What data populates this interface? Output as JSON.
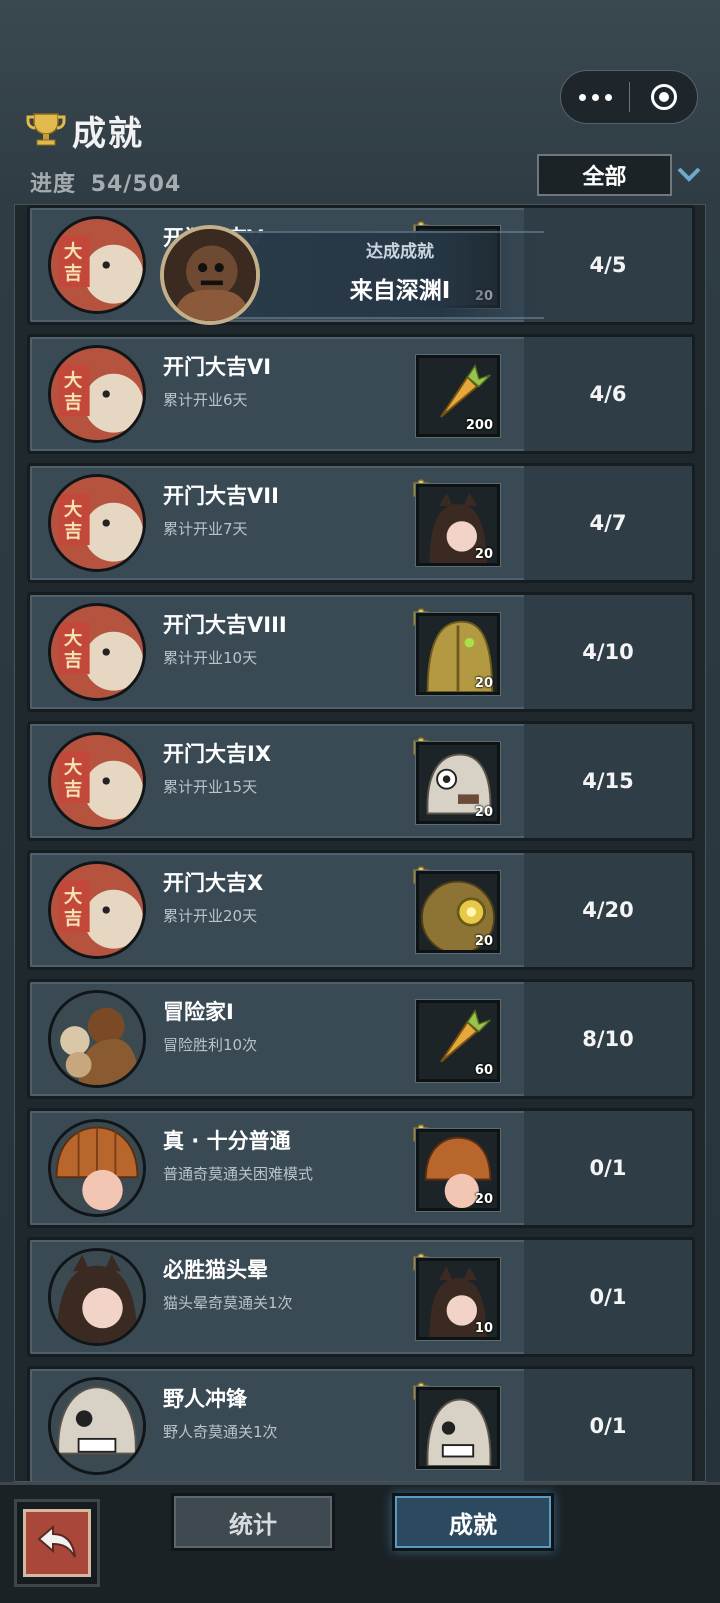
{
  "header": {
    "title": "成就",
    "progress_label": "进度",
    "progress_value": "54/504",
    "filter_value": "全部"
  },
  "toast": {
    "label": "达成成就",
    "title": "来自深渊I"
  },
  "achievements": [
    {
      "name": "开门大吉V",
      "desc": "",
      "reward_qty": "20",
      "count": "4/5",
      "portrait": "daji-lion-portrait"
    },
    {
      "name": "开门大吉VI",
      "desc": "累计开业6天",
      "reward_qty": "200",
      "count": "4/6",
      "portrait": "daji-lion-portrait",
      "reward_icon": "carrot-icon"
    },
    {
      "name": "开门大吉VII",
      "desc": "累计开业7天",
      "reward_qty": "20",
      "count": "4/7",
      "portrait": "daji-lion-portrait",
      "reward_icon": "cat-girl-shard-icon"
    },
    {
      "name": "开门大吉VIII",
      "desc": "累计开业10天",
      "reward_qty": "20",
      "count": "4/10",
      "portrait": "daji-lion-portrait",
      "reward_icon": "golden-helmet-shard-icon"
    },
    {
      "name": "开门大吉IX",
      "desc": "累计开业15天",
      "reward_qty": "20",
      "count": "4/15",
      "portrait": "daji-lion-portrait",
      "reward_icon": "skull-mask-shard-icon"
    },
    {
      "name": "开门大吉X",
      "desc": "累计开业20天",
      "reward_qty": "20",
      "count": "4/20",
      "portrait": "daji-lion-portrait",
      "reward_icon": "brass-diver-shard-icon"
    },
    {
      "name": "冒险家I",
      "desc": "冒险胜利10次",
      "reward_qty": "60",
      "count": "8/10",
      "portrait": "adventurer-portrait",
      "reward_icon": "carrot-icon"
    },
    {
      "name": "真 · 十分普通",
      "desc": "普通奇莫通关困难模式",
      "reward_qty": "20",
      "count": "0/1",
      "portrait": "pumpkin-head-portrait",
      "reward_icon": "pumpkin-head-shard-icon"
    },
    {
      "name": "必胜猫头晕",
      "desc": "猫头晕奇莫通关1次",
      "reward_qty": "10",
      "count": "0/1",
      "portrait": "cat-girl-portrait",
      "reward_icon": "cat-girl-shard-icon"
    },
    {
      "name": "野人冲锋",
      "desc": "野人奇莫通关1次",
      "reward_qty": "",
      "count": "0/1",
      "portrait": "savage-portrait",
      "reward_icon": "savage-shard-icon"
    }
  ],
  "bottom_nav": {
    "tab_stats": "统计",
    "tab_achievements": "成就"
  },
  "colors": {
    "row_bg": "#3a4a55",
    "count_bg": "#2f3d47",
    "active_tab": "#2c4a5f",
    "back_button": "#a9473a"
  }
}
